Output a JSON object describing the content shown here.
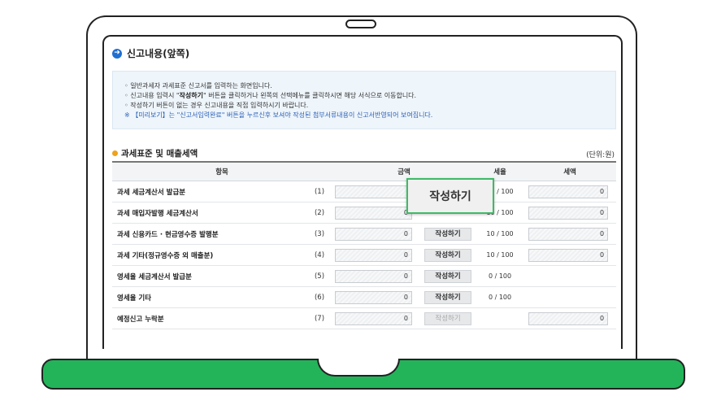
{
  "section": {
    "title": "신고내용(앞쪽)",
    "icon": "arrow-right-icon"
  },
  "info": {
    "line1": "◦ 일반과세자 과세표준 신고서를 입력하는 화면입니다.",
    "line2_pre": "◦ 신고내용 입력시 \"",
    "line2_bold": "작성하기",
    "line2_post": "\" 버튼을 클릭하거나 왼쪽의 선택메뉴를 클릭하시면 해당 서식으로 이동합니다.",
    "line3": "◦ 작성하기 버튼이 없는 경우 신고내용을 직접 입력하시기 바랍니다.",
    "note": "※ 【미리보기】는 \"신고서입력완료\" 버튼을 누르신후 보셔야 작성된 첨부서류내용이 신고서반영되어 보여집니다."
  },
  "subsection": {
    "title": "과세표준 및 매출세액",
    "unit": "(단위:원)"
  },
  "table": {
    "headers": {
      "item": "항목",
      "amount": "금액",
      "rate": "세율",
      "tax": "세액"
    },
    "rows": [
      {
        "label": "과세 세금계산서 발급분",
        "num": "(1)",
        "amount": "",
        "button": "",
        "rate": "10 / 100",
        "tax": "0"
      },
      {
        "label": "과세 매입자발행 세금계산서",
        "num": "(2)",
        "amount": "0",
        "button": "",
        "rate": "10 / 100",
        "tax": "0"
      },
      {
        "label": "과세 신용카드 · 현금영수증 발행분",
        "num": "(3)",
        "amount": "0",
        "button": "작성하기",
        "rate": "10 / 100",
        "tax": "0"
      },
      {
        "label": "과세 기타(정규영수증 외 매출분)",
        "num": "(4)",
        "amount": "0",
        "button": "작성하기",
        "rate": "10 / 100",
        "tax": "0"
      },
      {
        "label": "영세율 세금계산서 발급분",
        "num": "(5)",
        "amount": "0",
        "button": "작성하기",
        "rate": "0 / 100",
        "tax": ""
      },
      {
        "label": "영세율 기타",
        "num": "(6)",
        "amount": "0",
        "button": "작성하기",
        "rate": "0 / 100",
        "tax": ""
      },
      {
        "label": "예정신고 누락분",
        "num": "(7)",
        "amount": "0",
        "button": "작성하기",
        "rate": "",
        "tax": "0"
      }
    ]
  },
  "popup": {
    "label": "작성하기"
  }
}
